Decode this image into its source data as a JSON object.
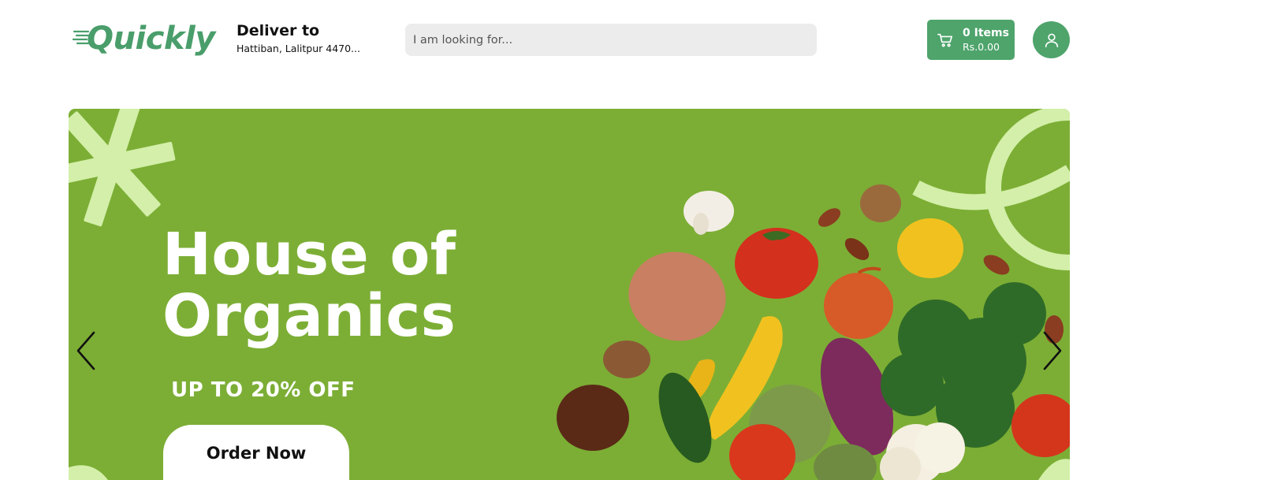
{
  "header": {
    "logo_text": "Quickly",
    "deliver_title": "Deliver to",
    "deliver_address": "Hattiban, Lalitpur 4470...",
    "search_placeholder": "I am looking for...",
    "cart_items": "0 Items",
    "cart_total": "Rs.0.00"
  },
  "banner": {
    "title": "House of\nOrganics",
    "subtitle": "UP TO 20% OFF",
    "button_label": "Order Now",
    "prev_icon": "chevron-left-icon",
    "next_icon": "chevron-right-icon"
  },
  "colors": {
    "brand_green": "#4ea46b",
    "banner_green": "#7cae35",
    "accent_light_green": "#d3efa9",
    "search_bg": "#ececec"
  }
}
